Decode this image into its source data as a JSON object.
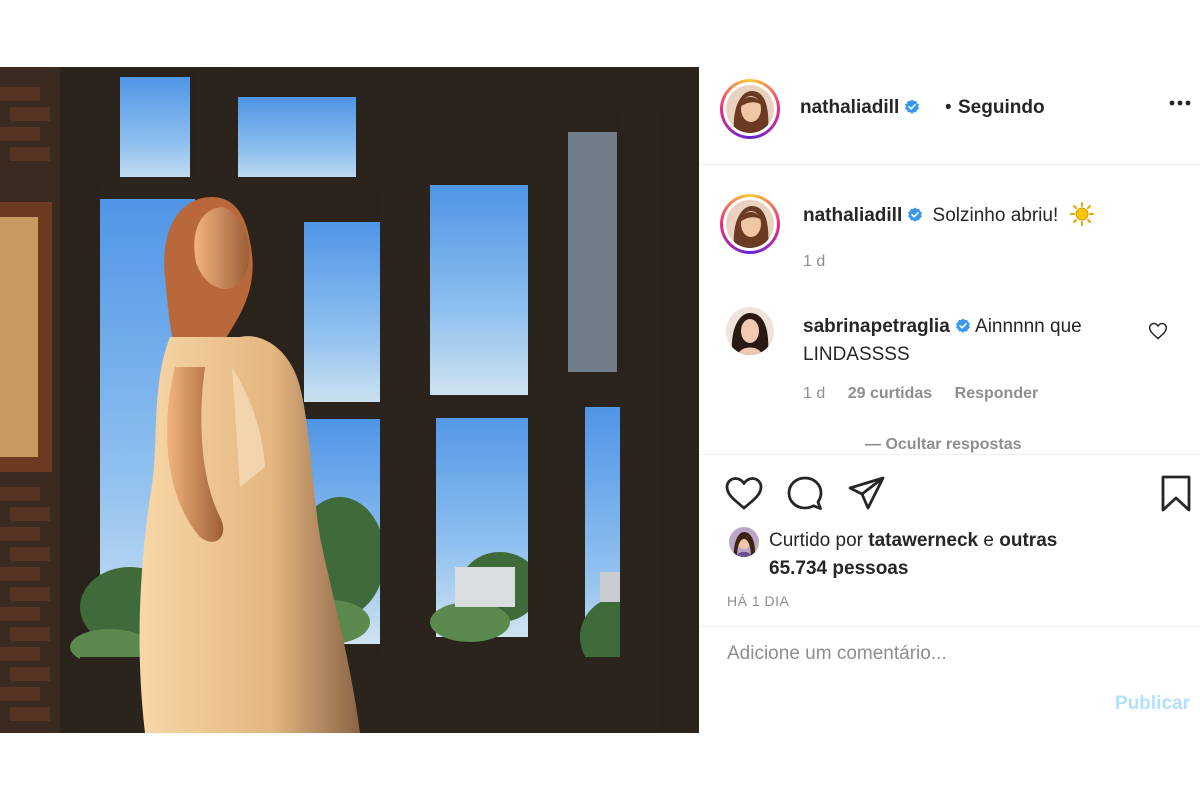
{
  "post": {
    "author": "nathaliadill",
    "separator": "•",
    "follow_status": "Seguindo",
    "caption": {
      "username": "nathaliadill",
      "text": "Solzinho abriu!",
      "emoji_icon": "sun-emoji-icon",
      "time": "1 d"
    },
    "comments": [
      {
        "username": "sabrinapetraglia",
        "text": "Ainnnnn que LINDASSSS",
        "time": "1 d",
        "likes": "29 curtidas",
        "reply_label": "Responder",
        "hide_replies": "— Ocultar respostas"
      }
    ],
    "likes": {
      "prefix": "Curtido por",
      "user": "tatawerneck",
      "connector": "e",
      "others": "outras 65.734 pessoas"
    },
    "date": "HÁ 1 DIA",
    "comment_input": {
      "placeholder": "Adicione um comentário...",
      "publish_label": "Publicar"
    },
    "icons": {
      "more": "more-options-icon",
      "verified": "verified-badge-icon",
      "like": "heart-icon",
      "comment": "comment-icon",
      "share": "share-icon",
      "save": "bookmark-icon"
    },
    "colors": {
      "verified": "#3897f0",
      "muted": "#8e8e8e",
      "publish_disabled": "#b2dffc"
    }
  }
}
